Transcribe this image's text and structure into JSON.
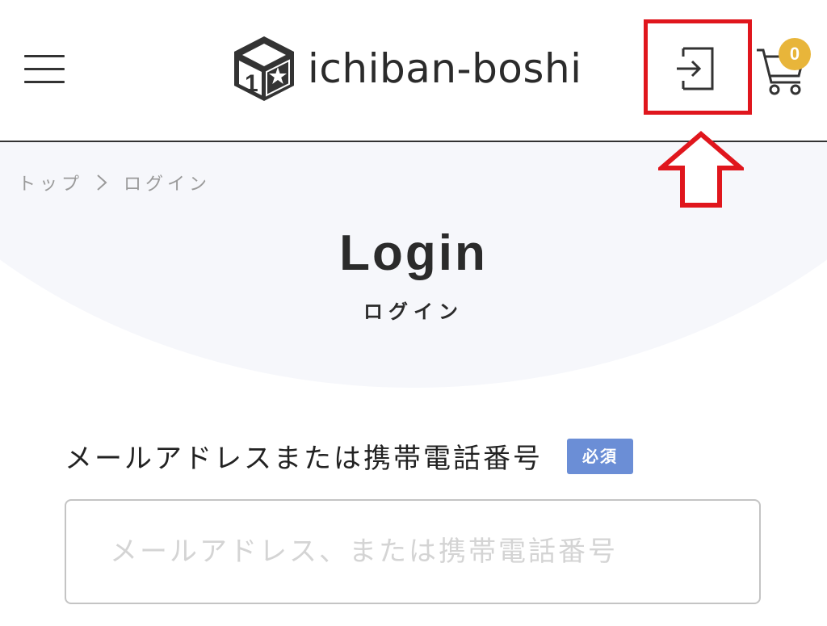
{
  "header": {
    "menu_icon": "hamburger-menu-icon",
    "logo": {
      "mark_icon": "cube-star-logo-icon",
      "mark_text": "1",
      "text": "ichiban-boshi"
    },
    "login_icon": "sign-in-icon",
    "cart": {
      "icon": "shopping-cart-icon",
      "count": "0"
    }
  },
  "annotation": {
    "box_color": "#e0161d",
    "arrow_icon": "up-arrow-outline-icon"
  },
  "breadcrumb": {
    "items": [
      "トップ",
      "ログイン"
    ],
    "separator_icon": "chevron-right-icon"
  },
  "page": {
    "title": "Login",
    "subtitle": "ログイン"
  },
  "form": {
    "email_label": "メールアドレスまたは携帯電話番号",
    "required_badge": "必須",
    "email_placeholder": "メールアドレス、または携帯電話番号",
    "email_value": ""
  },
  "colors": {
    "accent_required": "#6b8ed6",
    "cart_badge": "#e8b53a",
    "hero_bg": "#f6f7fb"
  }
}
